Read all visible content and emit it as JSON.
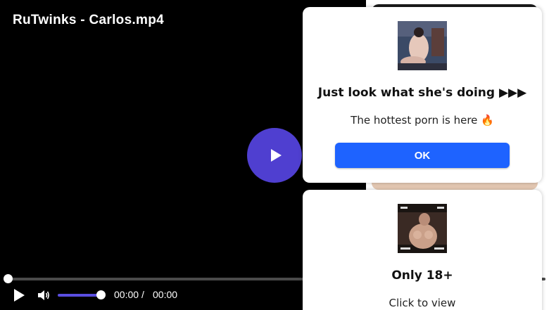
{
  "video": {
    "title": "RuTwinks - Carlos.mp4",
    "accent_color": "#4f3fd0",
    "big_play_icon": "play-icon"
  },
  "controls": {
    "play_icon": "play-icon",
    "volume_icon": "volume-icon",
    "progress_fraction": 0,
    "volume_fraction": 1,
    "time_current": "00:00",
    "time_separator": "/",
    "time_duration": "00:00"
  },
  "popups": [
    {
      "heading": "Just look what she's doing ▶▶▶",
      "subtext": "The hottest porn is here 🔥",
      "button_label": "OK",
      "button_color": "#1e63ff"
    },
    {
      "heading": "Only 18+",
      "subtext": "Click to view"
    }
  ]
}
